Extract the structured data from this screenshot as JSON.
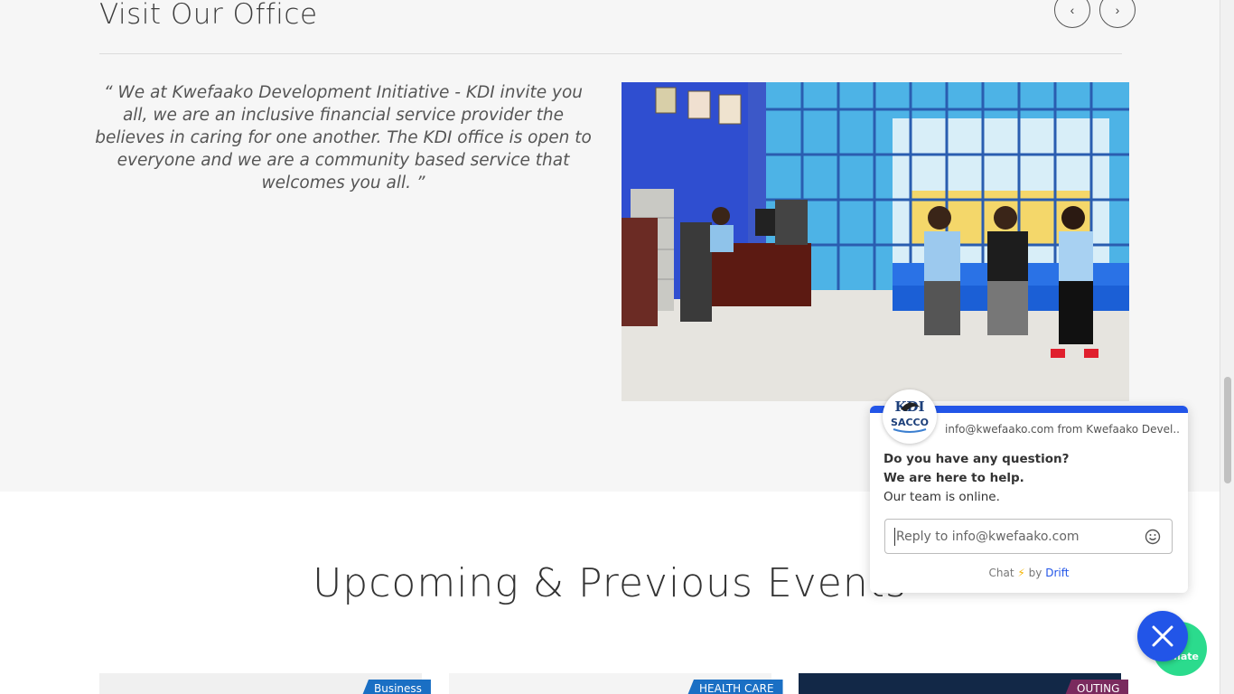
{
  "office": {
    "title": "Visit Our Office",
    "prev_label": "‹",
    "next_label": "›",
    "quote": "“ We at Kwefaako Development Initiative - KDI invite you all, we are an inclusive financial service provider the believes in caring for one another. The KDI office is open to everyone and we are a community based service that welcomes you all. ”"
  },
  "events": {
    "title": "Upcoming & Previous Events",
    "cards": [
      {
        "tag": "Business",
        "tag_color": "#1a6fc4"
      },
      {
        "tag": "HEALTH CARE",
        "tag_color": "#1a6fc4"
      },
      {
        "tag": "OUTING",
        "tag_color": "#7a2a5e"
      }
    ]
  },
  "chat": {
    "logo_text": "SACCO",
    "logo_mark": "KDI",
    "sender": "info@kwefaako.com from Kwefaako Devel...",
    "line1": "Do you have any question?",
    "line2": "We are here to help.",
    "line3": "Our team is online.",
    "input_placeholder": "Reply to info@kwefaako.com",
    "input_value": "",
    "footer_chat": "Chat",
    "footer_by": "by",
    "footer_brand": "Drift",
    "accent": "#2255e8"
  },
  "floating": {
    "donate_label": "nate",
    "close_icon": "close-icon"
  }
}
